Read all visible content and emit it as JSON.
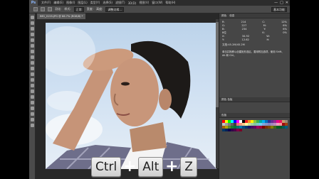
{
  "app": {
    "logo": "Ps",
    "menu": [
      "文件(F)",
      "编辑(E)",
      "图像(I)",
      "图层(L)",
      "类型(Y)",
      "选择(S)",
      "滤镜(T)",
      "3D(D)",
      "视图(V)",
      "窗口(W)",
      "帮助(H)"
    ],
    "window_buttons": [
      "—",
      "□",
      "✕"
    ]
  },
  "options_bar": {
    "feather_label": "羽化:",
    "style_label": "样式:",
    "style_value": "正常",
    "width_label": "宽度:",
    "height_label": "高度:",
    "refine_edge": "调整边缘...",
    "workspace": "基本功能"
  },
  "document": {
    "tab_label": "IMG_0155.JPG @ 66.7% (RGB/8) *"
  },
  "panel": {
    "tabs": [
      "颜色",
      "信息"
    ],
    "info_rows": [
      {
        "left": "R:",
        "mid": "214",
        "right_label": "C:",
        "right_value": "12%"
      },
      {
        "left": "G:",
        "mid": "227",
        "right_label": "M:",
        "right_value": "6%"
      },
      {
        "left": "B:",
        "mid": "234",
        "right_label": "Y:",
        "right_value": "6%"
      },
      {
        "left": "8位",
        "mid": "",
        "right_label": "K:",
        "right_value": "0%"
      },
      {
        "left": "X:",
        "mid": "34.92",
        "right_label": "W:",
        "right_value": ""
      },
      {
        "left": "Y:",
        "mid": "12.62",
        "right_label": "H:",
        "right_value": ""
      }
    ],
    "doc_size": "文档:45.2M/45.2M",
    "hint_text": "单击并拖移以创建矩形选区。要用附加选项，使用 Shift、Alt 和 Ctrl。",
    "swatches_tab": "色板",
    "lower_header": "颜色 色板"
  },
  "swatch_colors": [
    "#ff0000",
    "#ffff00",
    "#00ff00",
    "#00ffff",
    "#0000ff",
    "#ff00ff",
    "#ffffff",
    "#000000",
    "#ed1c24",
    "#f7941d",
    "#fff200",
    "#8dc63f",
    "#39b54a",
    "#00a99d",
    "#00aeef",
    "#0072bc",
    "#2e3192",
    "#662d91",
    "#92278f",
    "#ec008c",
    "#ed145b",
    "#c69c6d",
    "#998675",
    "#c2c2c2",
    "#a0a0a0",
    "#7d7d7d",
    "#5e5e5e",
    "#404040",
    "#f26d7d",
    "#f7977a",
    "#fdc689",
    "#fff799",
    "#c4df9b",
    "#a3d39c",
    "#82ca9d",
    "#7accc8",
    "#6dcff6",
    "#7da7d9",
    "#8393ca",
    "#8781bd",
    "#a187be",
    "#bd8cbf",
    "#f49ac1",
    "#f6989d",
    "#9e0b0f",
    "#a0410d",
    "#a36209",
    "#aba000",
    "#598527",
    "#1a7b30",
    "#007236",
    "#00746b",
    "#0076a3",
    "#004b80",
    "#003471",
    "#1b1464",
    "#440e62",
    "#630460",
    "#9e005d",
    "#9e0039",
    "#790000",
    "#7b2e00",
    "#7d4900",
    "#827b00",
    "#406618",
    "#005e20",
    "#005826",
    "#005952",
    "#005b7f",
    "#003663",
    "#002157",
    "#0d004c",
    "#32004b",
    "#4b0049",
    "#7b0046",
    "#7a0026"
  ],
  "shortcut": {
    "key1": "Ctrl",
    "key2": "Alt",
    "key3": "Z",
    "plus": "+"
  }
}
